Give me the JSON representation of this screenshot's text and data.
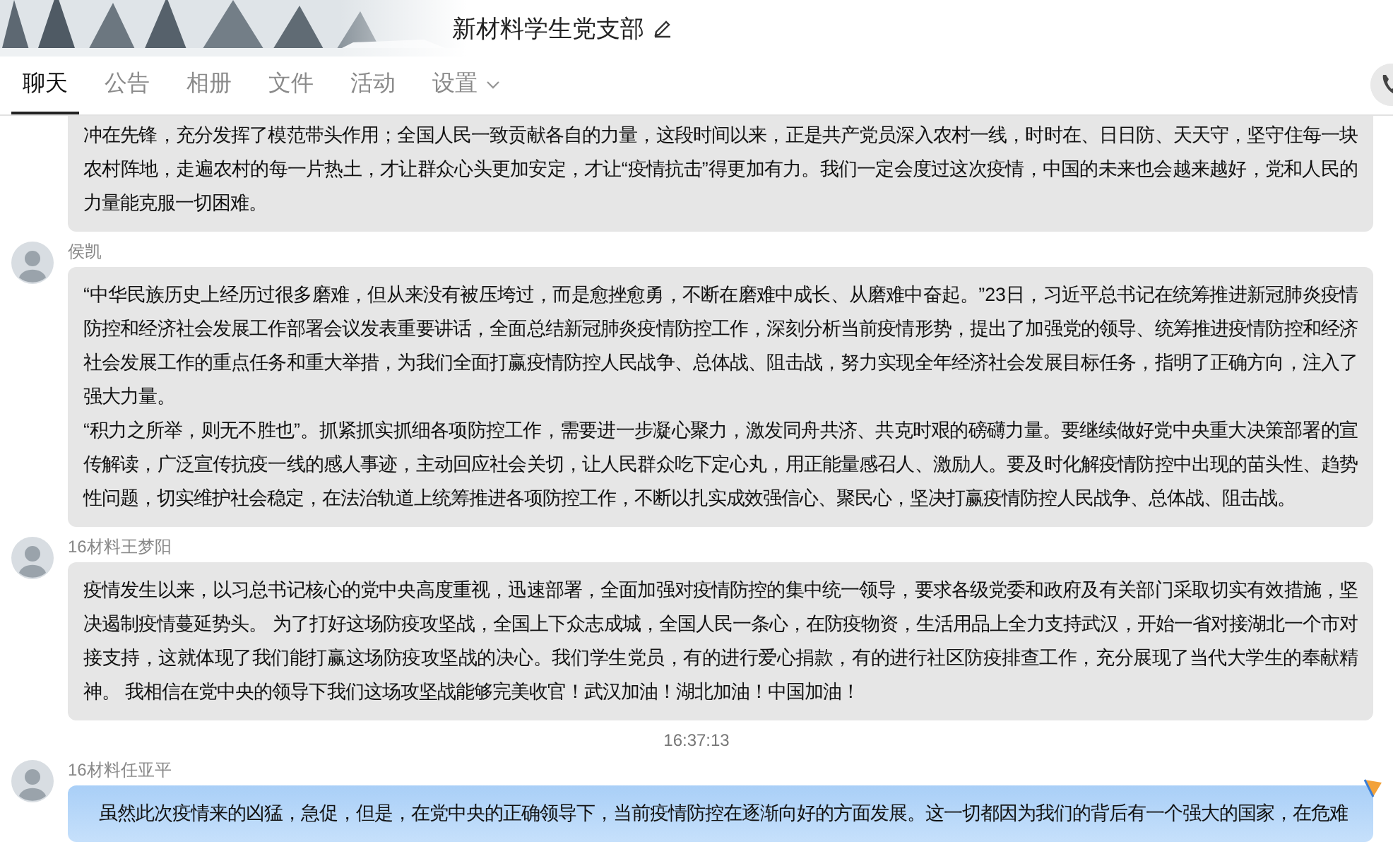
{
  "header": {
    "title": "新材料学生党支部"
  },
  "tabs": [
    {
      "label": "聊天",
      "selected": true
    },
    {
      "label": "公告",
      "selected": false
    },
    {
      "label": "相册",
      "selected": false
    },
    {
      "label": "文件",
      "selected": false
    },
    {
      "label": "活动",
      "selected": false
    },
    {
      "label": "设置",
      "selected": false,
      "dropdown": true
    }
  ],
  "messages": [
    {
      "kind": "plain",
      "continued": true,
      "paragraphs": [
        "冲在先锋，充分发挥了模范带头作用；全国人民一致贡献各自的力量，这段时间以来，正是共产党员深入农村一线，时时在、日日防、天天守，坚守住每一块农村阵地，走遍农村的每一片热土，才让群众心头更加安定，才让“疫情抗击”得更加有力。我们一定会度过这次疫情，中国的未来也会越来越好，党和人民的力量能克服一切困难。"
      ]
    },
    {
      "kind": "plain",
      "sender": "侯凯",
      "avatar": true,
      "paragraphs": [
        "“中华民族历史上经历过很多磨难，但从来没有被压垮过，而是愈挫愈勇，不断在磨难中成长、从磨难中奋起。”23日，习近平总书记在统筹推进新冠肺炎疫情防控和经济社会发展工作部署会议发表重要讲话，全面总结新冠肺炎疫情防控工作，深刻分析当前疫情形势，提出了加强党的领导、统筹推进疫情防控和经济社会发展工作的重点任务和重大举措，为我们全面打赢疫情防控人民战争、总体战、阻击战，努力实现全年经济社会发展目标任务，指明了正确方向，注入了强大力量。",
        "“积力之所举，则无不胜也”。抓紧抓实抓细各项防控工作，需要进一步凝心聚力，激发同舟共济、共克时艰的磅礴力量。要继续做好党中央重大决策部署的宣传解读，广泛宣传抗疫一线的感人事迹，主动回应社会关切，让人民群众吃下定心丸，用正能量感召人、激励人。要及时化解疫情防控中出现的苗头性、趋势性问题，切实维护社会稳定，在法治轨道上统筹推进各项防控工作，不断以扎实成效强信心、聚民心，坚决打赢疫情防控人民战争、总体战、阻击战。"
      ]
    },
    {
      "kind": "plain",
      "sender": "16材料王梦阳",
      "avatar": true,
      "paragraphs": [
        "疫情发生以来，以习总书记核心的党中央高度重视，迅速部署，全面加强对疫情防控的集中统一领导，要求各级党委和政府及有关部门采取切实有效措施，坚决遏制疫情蔓延势头。 为了打好这场防疫攻坚战，全国上下众志成城，全国人民一条心，在防疫物资，生活用品上全力支持武汉，开始一省对接湖北一个市对接支持，这就体现了我们能打赢这场防疫攻坚战的决心。我们学生党员，有的进行爱心捐款，有的进行社区防疫排查工作，充分展现了当代大学生的奉献精神。 我相信在党中央的领导下我们这场攻坚战能够完美收官！武汉加油！湖北加油！中国加油！"
      ]
    },
    {
      "kind": "time",
      "text": "16:37:13"
    },
    {
      "kind": "colorful",
      "sender": "16材料任亚平",
      "avatar": true,
      "paragraphs": [
        "虽然此次疫情来的凶猛，急促，但是，在党中央的正确领导下，当前疫情防控在逐渐向好的方面发展。这一切都因为我们的背后有一个强大的国家，在危难"
      ]
    }
  ]
}
